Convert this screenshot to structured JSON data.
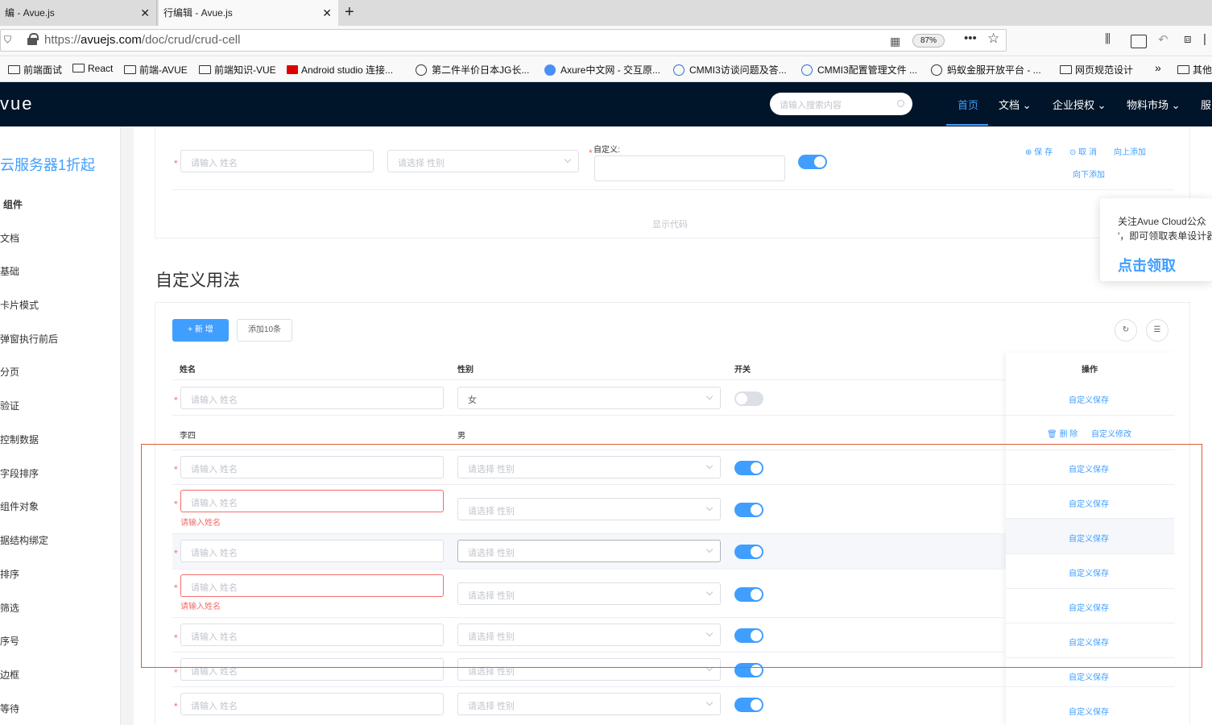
{
  "browser": {
    "tabs": [
      {
        "title": "编 - Avue.js"
      },
      {
        "title": "行编辑 - Avue.js"
      }
    ],
    "url_prefix": "https://",
    "url_domain": "avuejs.com",
    "url_path": "/doc/crud/crud-cell",
    "zoom": "87%",
    "bookmarks": [
      "前端面试",
      "React",
      "前端-AVUE",
      "前端知识-VUE",
      "Android studio 连接...",
      "第二件半价日本JG长...",
      "Axure中文网 - 交互原...",
      "CMMI3访谈问题及答...",
      "CMMI3配置管理文件 ...",
      "蚂蚁金服开放平台 - ...",
      "网页规范设计",
      "其他"
    ]
  },
  "site": {
    "logo": "vue",
    "search_placeholder": "请输入搜索内容",
    "nav": [
      "首页",
      "文档",
      "企业授权",
      "物料市场",
      "服"
    ]
  },
  "sidebar": {
    "promo": "云服务器1折起",
    "heading": "组件",
    "items": [
      "文档",
      "基础",
      "卡片模式",
      "弹窗执行前后",
      "分页",
      "验证",
      "控制数据",
      "字段排序",
      "组件对象",
      "据结构绑定",
      "排序",
      "筛选",
      "序号",
      "边框",
      "等待"
    ]
  },
  "top_demo": {
    "name_placeholder": "请输入 姓名",
    "sex_placeholder": "请选择 性别",
    "custom_label": "自定义:",
    "actions": [
      "保 存",
      "取 消",
      "向上添加",
      "向下添加"
    ],
    "show_code": "显示代码"
  },
  "popup": {
    "line1": "关注Avue   Cloud公众",
    "line2": "'，即可领取表单设计器",
    "cta": "点击领取"
  },
  "section_title": "自定义用法",
  "toolbar": {
    "add_label": "+ 新 增",
    "add10_label": "添加10条"
  },
  "table": {
    "columns": [
      "姓名",
      "性别",
      "开关",
      "操作"
    ],
    "name_placeholder": "请输入 姓名",
    "sex_placeholder": "请选择 性别",
    "error_text": "请输入姓名",
    "save_label": "自定义保存",
    "delete_label": "删 除",
    "edit_label": "自定义修改",
    "row1_sex": "女",
    "row2_name": "李四",
    "row2_sex": "男"
  }
}
